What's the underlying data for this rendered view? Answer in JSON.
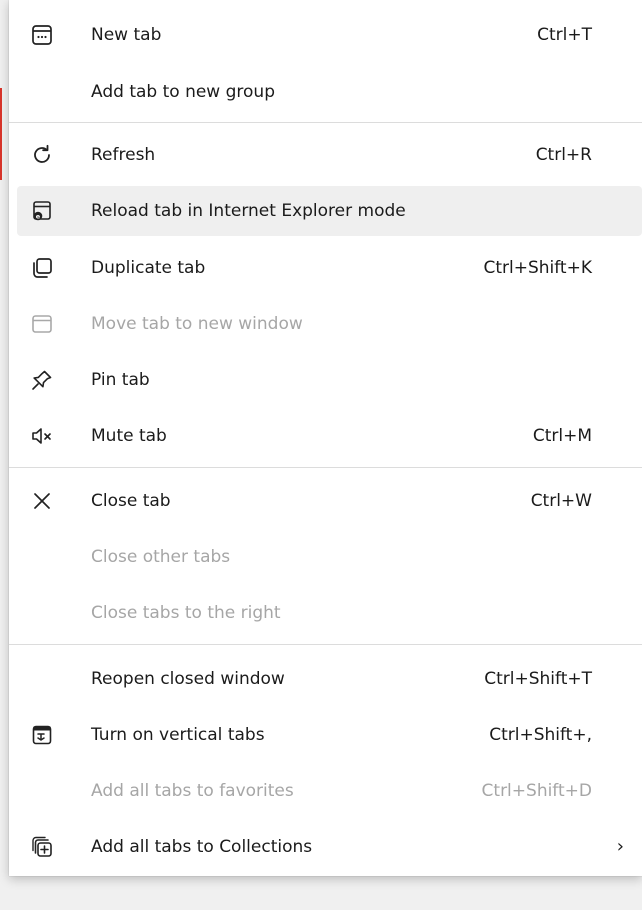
{
  "menu": {
    "items": [
      {
        "label": "New tab",
        "shortcut": "Ctrl+T",
        "icon": "new-tab-icon",
        "enabled": true
      },
      {
        "label": "Add tab to new group",
        "shortcut": "",
        "icon": "",
        "enabled": true
      },
      {
        "label": "Refresh",
        "shortcut": "Ctrl+R",
        "icon": "refresh-icon",
        "enabled": true
      },
      {
        "label": "Reload tab in Internet Explorer mode",
        "shortcut": "",
        "icon": "ie-mode-icon",
        "enabled": true,
        "hovered": true
      },
      {
        "label": "Duplicate tab",
        "shortcut": "Ctrl+Shift+K",
        "icon": "duplicate-tab-icon",
        "enabled": true
      },
      {
        "label": "Move tab to new window",
        "shortcut": "",
        "icon": "move-window-icon",
        "enabled": false
      },
      {
        "label": "Pin tab",
        "shortcut": "",
        "icon": "pin-icon",
        "enabled": true
      },
      {
        "label": "Mute tab",
        "shortcut": "Ctrl+M",
        "icon": "mute-icon",
        "enabled": true
      },
      {
        "label": "Close tab",
        "shortcut": "Ctrl+W",
        "icon": "close-icon",
        "enabled": true
      },
      {
        "label": "Close other tabs",
        "shortcut": "",
        "icon": "",
        "enabled": false
      },
      {
        "label": "Close tabs to the right",
        "shortcut": "",
        "icon": "",
        "enabled": false
      },
      {
        "label": "Reopen closed window",
        "shortcut": "Ctrl+Shift+T",
        "icon": "",
        "enabled": true
      },
      {
        "label": "Turn on vertical tabs",
        "shortcut": "Ctrl+Shift+,",
        "icon": "vertical-tabs-icon",
        "enabled": true
      },
      {
        "label": "Add all tabs to favorites",
        "shortcut": "Ctrl+Shift+D",
        "icon": "",
        "enabled": false
      },
      {
        "label": "Add all tabs to Collections",
        "shortcut": "",
        "icon": "collections-icon",
        "enabled": true,
        "submenu": "›"
      }
    ]
  },
  "colors": {
    "hover_background": "#efefef",
    "disabled_text": "#a6a6a6",
    "text": "#1b1b1b",
    "divider": "#dcdcdc"
  }
}
